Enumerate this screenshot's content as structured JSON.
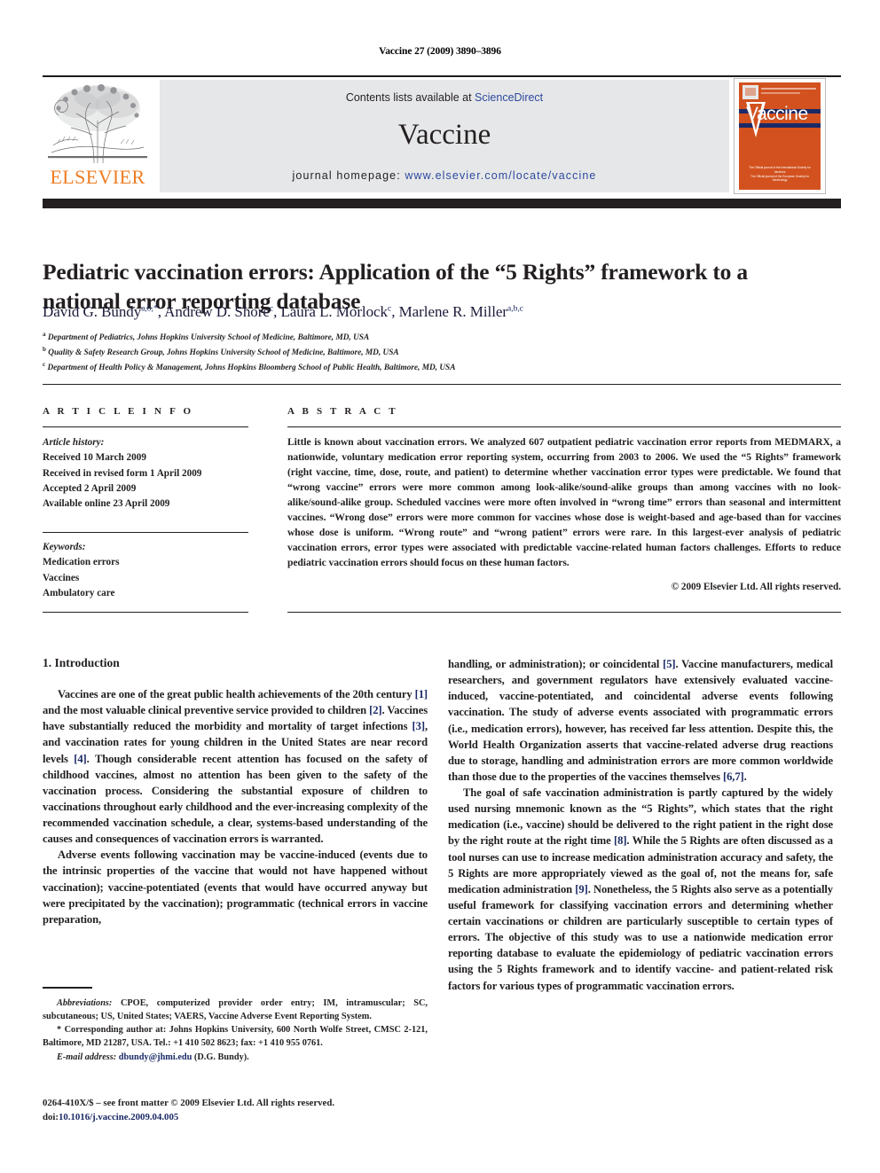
{
  "running_head": "Vaccine 27 (2009) 3890–3896",
  "masthead": {
    "publisher_name": "ELSEVIER",
    "contents_prefix": "Contents lists available at ",
    "contents_link": "ScienceDirect",
    "journal_title": "Vaccine",
    "homepage_prefix": "journal homepage: ",
    "homepage_url": "www.elsevier.com/locate/vaccine",
    "cover": {
      "journal_name": "Vaccine",
      "footer_line1": "The Official journal of the International Society for Vaccines",
      "footer_line2": "The Official journal of the  European Society for Vaccinology"
    }
  },
  "article": {
    "title": "Pediatric vaccination errors: Application of the “5 Rights” framework to a national error reporting database",
    "authors_html": "David G. Bundy<sup>a,b,</sup><sup>*</sup>, Andrew D. Shore<sup>c</sup>, Laura L. Morlock<sup>c</sup>, Marlene R. Miller<sup>a,b,c</sup>",
    "affiliations": [
      {
        "marker": "a",
        "text": "Department of Pediatrics, Johns Hopkins University School of Medicine, Baltimore, MD, USA"
      },
      {
        "marker": "b",
        "text": "Quality & Safety Research Group, Johns Hopkins University School of Medicine, Baltimore, MD, USA"
      },
      {
        "marker": "c",
        "text": "Department of Health Policy & Management, Johns Hopkins Bloomberg School of Public Health, Baltimore, MD, USA"
      }
    ]
  },
  "article_info": {
    "heading": "A R T I C L E    I N F O",
    "history_label": "Article history:",
    "history": [
      "Received 10 March 2009",
      "Received in revised form 1 April 2009",
      "Accepted 2 April 2009",
      "Available online 23 April 2009"
    ],
    "keywords_label": "Keywords:",
    "keywords": [
      "Medication errors",
      "Vaccines",
      "Ambulatory care"
    ]
  },
  "abstract": {
    "heading": "A B S T R A C T",
    "text": "Little is known about vaccination errors. We analyzed 607 outpatient pediatric vaccination error reports from MEDMARX, a nationwide, voluntary medication error reporting system, occurring from 2003 to 2006. We used the “5 Rights” framework (right vaccine, time, dose, route, and patient) to determine whether vaccination error types were predictable. We found that “wrong vaccine” errors were more common among look-alike/sound-alike groups than among vaccines with no look-alike/sound-alike group. Scheduled vaccines were more often involved in “wrong time” errors than seasonal and intermittent vaccines. “Wrong dose” errors were more common for vaccines whose dose is weight-based and age-based than for vaccines whose dose is uniform. “Wrong route” and “wrong patient” errors were rare. In this largest-ever analysis of pediatric vaccination errors, error types were associated with predictable vaccine-related human factors challenges. Efforts to reduce pediatric vaccination errors should focus on these human factors.",
    "copyright": "© 2009 Elsevier Ltd. All rights reserved."
  },
  "body": {
    "section1_title": "1.  Introduction",
    "left_paragraphs": [
      "Vaccines are one of the great public health achievements of the 20th century [1] and the most valuable clinical preventive service provided to children [2]. Vaccines have substantially reduced the morbidity and mortality of target infections [3], and vaccination rates for young children in the United States are near record levels [4]. Though considerable recent attention has focused on the safety of childhood vaccines, almost no attention has been given to the safety of the vaccination process. Considering the substantial exposure of children to vaccinations throughout early childhood and the ever-increasing complexity of the recommended vaccination schedule, a clear, systems-based understanding of the causes and consequences of vaccination errors is warranted.",
      "Adverse events following vaccination may be vaccine-induced (events due to the intrinsic properties of the vaccine that would not have happened without vaccination); vaccine-potentiated (events that would have occurred anyway but were precipitated by the vaccination); programmatic (technical errors in vaccine preparation,"
    ],
    "right_paragraphs": [
      "handling, or administration); or coincidental [5]. Vaccine manufacturers, medical researchers, and government regulators have extensively evaluated vaccine-induced, vaccine-potentiated, and coincidental adverse events following vaccination. The study of adverse events associated with programmatic errors (i.e., medication errors), however, has received far less attention. Despite this, the World Health Organization asserts that vaccine-related adverse drug reactions due to storage, handling and administration errors are more common worldwide than those due to the properties of the vaccines themselves [6,7].",
      "The goal of safe vaccination administration is partly captured by the widely used nursing mnemonic known as the “5 Rights”, which states that the right medication (i.e., vaccine) should be delivered to the right patient in the right dose by the right route at the right time [8]. While the 5 Rights are often discussed as a tool nurses can use to increase medication administration accuracy and safety, the 5 Rights are more appropriately viewed as the goal of, not the means for, safe medication administration [9]. Nonetheless, the 5 Rights also serve as a potentially useful framework for classifying vaccination errors and determining whether certain vaccinations or children are particularly susceptible to certain types of errors. The objective of this study was to use a nationwide medication error reporting database to evaluate the epidemiology of pediatric vaccination errors using the 5 Rights framework and to identify vaccine- and patient-related risk factors for various types of programmatic vaccination errors."
    ]
  },
  "footnotes": {
    "abbreviations_label": "Abbreviations:",
    "abbreviations_text": " CPOE, computerized provider order entry; IM, intramuscular; SC, subcutaneous; US, United States; VAERS, Vaccine Adverse Event Reporting System.",
    "corresponding_marker": "*",
    "corresponding_text": " Corresponding author at: Johns Hopkins University, 600 North Wolfe Street, CMSC 2-121, Baltimore, MD 21287, USA. Tel.: +1 410 502 8623; fax: +1 410 955 0761.",
    "email_label": "E-mail address:",
    "email": "dbundy@jhmi.edu",
    "email_suffix": " (D.G. Bundy)."
  },
  "imprint": {
    "line1": "0264-410X/$ – see front matter © 2009 Elsevier Ltd. All rights reserved.",
    "doi_label": "doi:",
    "doi": "10.1016/j.vaccine.2009.04.005"
  },
  "colors": {
    "accent_orange": "#ef7d22",
    "link_blue": "#2c4a9e",
    "ref_blue": "#1b2a66",
    "banner_gray": "#e6e7e8",
    "bar_black": "#231f20",
    "cover_orange": "#d2511e"
  }
}
